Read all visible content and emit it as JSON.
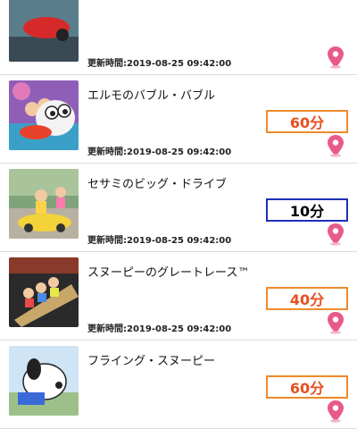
{
  "colors": {
    "wait_border_orange": "#f08a2a",
    "wait_text_orange": "#e8501e",
    "wait_border_blue": "#1f2fb8",
    "pin": "#e85a8a"
  },
  "attractions": [
    {
      "name": "",
      "wait": "",
      "updated": "更新時間:2019-08-25 09:42:00",
      "style": "none"
    },
    {
      "name": "エルモのバブル・バブル",
      "wait": "60分",
      "updated": "更新時間:2019-08-25 09:42:00",
      "style": "orange"
    },
    {
      "name": "セサミのビッグ・ドライブ",
      "wait": "10分",
      "updated": "更新時間:2019-08-25 09:42:00",
      "style": "blue"
    },
    {
      "name": "スヌーピーのグレートレース™",
      "wait": "40分",
      "updated": "更新時間:2019-08-25 09:42:00",
      "style": "orange"
    },
    {
      "name": "フライング・スヌーピー",
      "wait": "60分",
      "updated": "",
      "style": "orange"
    }
  ],
  "icons": {
    "map_pin": "map-pin-icon"
  }
}
